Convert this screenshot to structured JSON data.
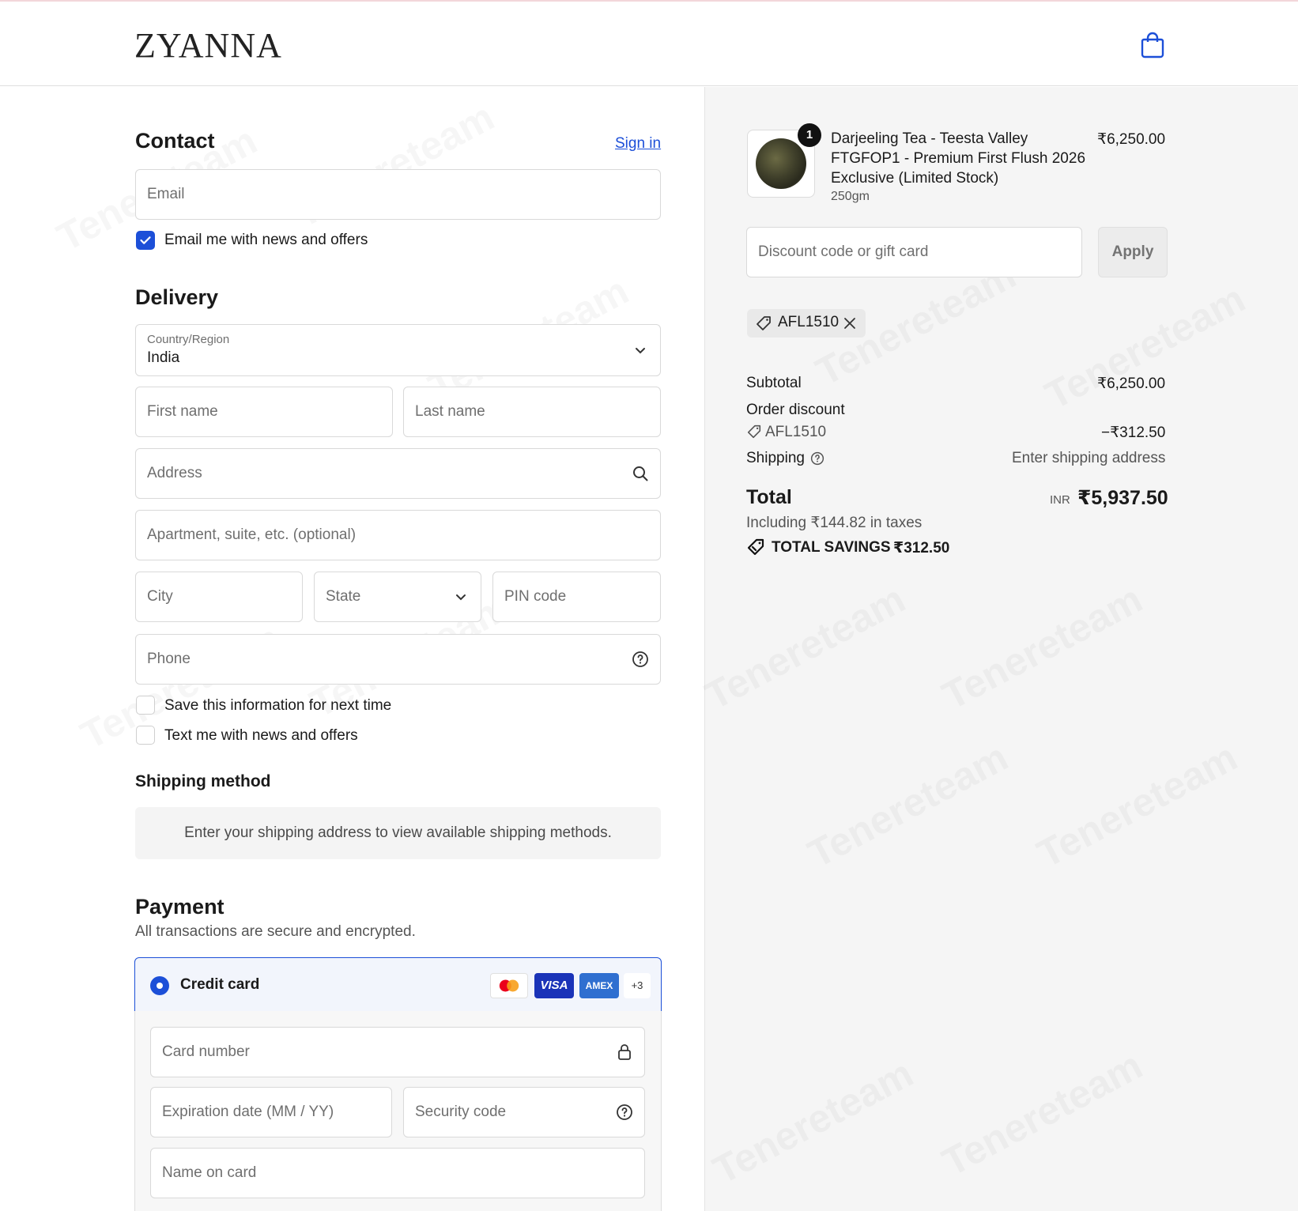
{
  "brand": {
    "logo_text": "ZYANNA"
  },
  "contact": {
    "title": "Contact",
    "sign_in": "Sign in",
    "email_placeholder": "Email",
    "newsletter_label": "Email me with news and offers",
    "newsletter_checked": true
  },
  "delivery": {
    "title": "Delivery",
    "country_label": "Country/Region",
    "country_value": "India",
    "first_name": "First name",
    "last_name": "Last name",
    "address": "Address",
    "apartment": "Apartment, suite, etc. (optional)",
    "city": "City",
    "state": "State",
    "pin": "PIN code",
    "phone": "Phone",
    "save_info": "Save this information for next time",
    "text_offers": "Text me with news and offers"
  },
  "shipping_method": {
    "title": "Shipping method",
    "notice": "Enter your shipping address to view available shipping methods."
  },
  "payment": {
    "title": "Payment",
    "subtitle": "All transactions are secure and encrypted.",
    "method_label": "Credit card",
    "card_logos": [
      "VISA",
      "AMEX"
    ],
    "more_cards": "+3",
    "card_number": "Card number",
    "expiry": "Expiration date (MM / YY)",
    "security_code": "Security code",
    "name_on_card": "Name on card"
  },
  "summary": {
    "item": {
      "quantity": "1",
      "name_line1": "Darjeeling Tea - Teesta Valley",
      "name_line2": "FTGFOP1 - Premium First Flush 2026",
      "name_line3": "Exclusive (Limited Stock)",
      "variant": "250gm",
      "price": "₹6,250.00"
    },
    "discount_placeholder": "Discount code or gift card",
    "apply": "Apply",
    "applied_code": "AFL1510",
    "subtotal_label": "Subtotal",
    "subtotal_value": "₹6,250.00",
    "order_discount_label": "Order discount",
    "order_discount_code": "AFL1510",
    "order_discount_value": "−₹312.50",
    "shipping_label": "Shipping",
    "shipping_value": "Enter shipping address",
    "total_label": "Total",
    "currency": "INR",
    "total_value": "₹5,937.50",
    "taxes_note": "Including ₹144.82 in taxes",
    "savings_label": "TOTAL SAVINGS",
    "savings_value": "₹312.50"
  },
  "colors": {
    "accent": "#1c4fd8",
    "visa": "#1a33b8",
    "amex": "#2f6fd0",
    "mastercard_red": "#eb001b",
    "mastercard_yellow": "#f79e1b"
  },
  "watermark_text": "Tenereteam"
}
